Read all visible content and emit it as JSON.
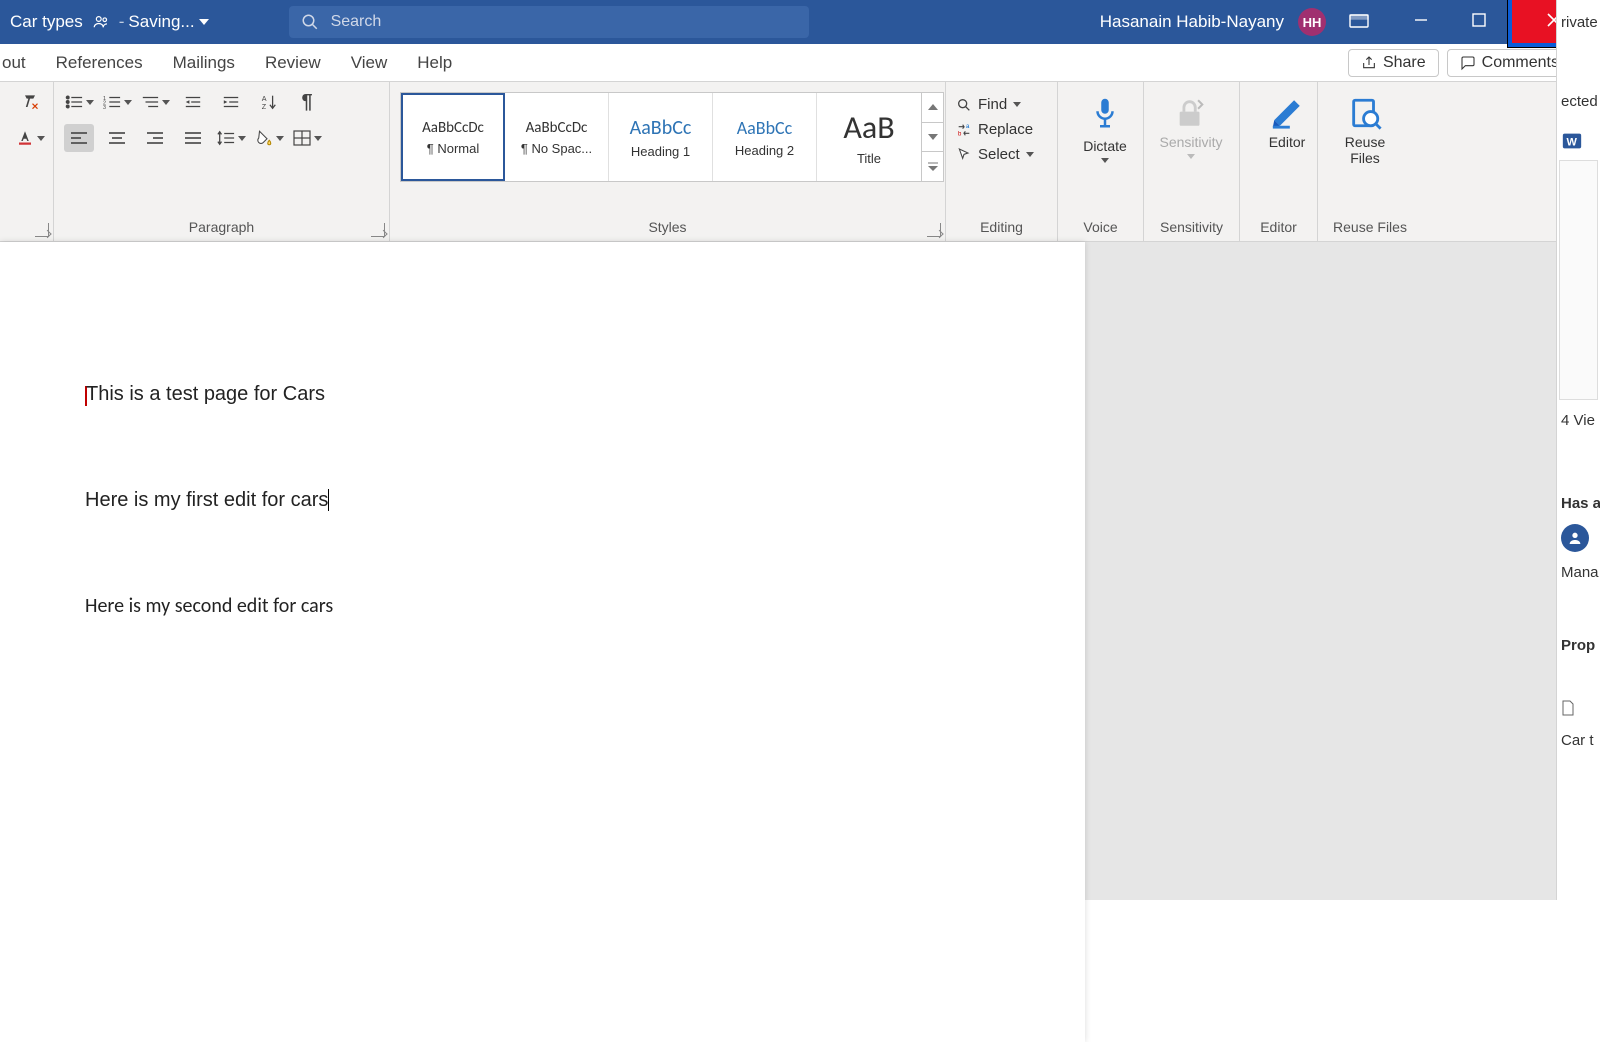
{
  "titlebar": {
    "doc_name": "Car types",
    "status_prefix": "-",
    "status": "Saving...",
    "search_placeholder": "Search",
    "user_name": "Hasanain Habib-Nayany",
    "user_initials": "HH"
  },
  "tabs": {
    "items": [
      "out",
      "References",
      "Mailings",
      "Review",
      "View",
      "Help"
    ],
    "share": "Share",
    "comments": "Comments"
  },
  "ribbon": {
    "paragraph_label": "Paragraph",
    "styles_label": "Styles",
    "editing_label": "Editing",
    "voice_label": "Voice",
    "sensitivity_label": "Sensitivity",
    "editor_label": "Editor",
    "reuse_label": "Reuse Files",
    "styles": [
      {
        "preview": "AaBbCcDc",
        "name": "¶ Normal",
        "size": "15px",
        "color": "#333"
      },
      {
        "preview": "AaBbCcDc",
        "name": "¶ No Spac...",
        "size": "15px",
        "color": "#333"
      },
      {
        "preview": "AaBbCc",
        "name": "Heading 1",
        "size": "20px",
        "color": "#2e74b5"
      },
      {
        "preview": "AaBbCc",
        "name": "Heading 2",
        "size": "18px",
        "color": "#2e74b5"
      },
      {
        "preview": "AaB",
        "name": "Title",
        "size": "32px",
        "color": "#333"
      }
    ],
    "editing": {
      "find": "Find",
      "replace": "Replace",
      "select": "Select"
    },
    "dictate": "Dictate",
    "sensitivity": "Sensitivity",
    "editor": "Editor",
    "reuse_l1": "Reuse",
    "reuse_l2": "Files"
  },
  "document": {
    "p1": "This is a test page for Cars",
    "p2": "Here is my first edit for cars",
    "p3": "Here is my second edit for cars"
  },
  "sidepane": {
    "frag1": "rivate",
    "frag2": "ected",
    "views": "4 Vie",
    "has": "Has a",
    "mana": "Mana",
    "prop": "Prop",
    "car": "Car t"
  }
}
